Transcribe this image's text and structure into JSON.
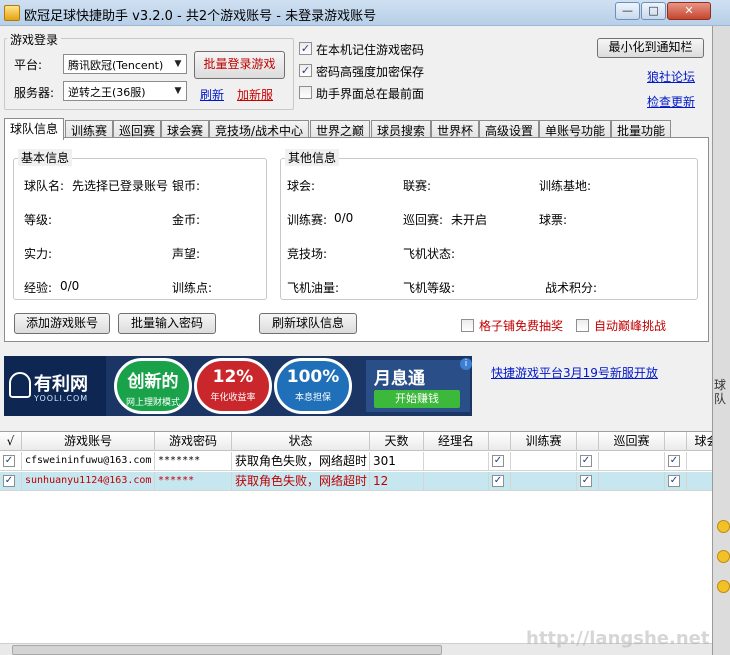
{
  "window": {
    "title": "欧冠足球快捷助手 v3.2.0  - 共2个游戏账号 - 未登录游戏账号",
    "minimize": "—",
    "maximize": "□",
    "close": "✕"
  },
  "login": {
    "group_title": "游戏登录",
    "platform_label": "平台:",
    "platform_value": "腾讯欧冠(Tencent)",
    "server_label": "服务器:",
    "server_value": "逆转之王(36服)",
    "batch_login_button": "批量登录游戏",
    "refresh_link": "刷新",
    "add_server_link": "加新服"
  },
  "options": {
    "remember_password": "在本机记住游戏密码",
    "encrypt_password": "密码高强度加密保存",
    "always_on_top": "助手界面总在最前面"
  },
  "right_panel": {
    "minimize_tray_button": "最小化到通知栏",
    "forum_link": "狼社论坛",
    "check_update_link": "检查更新"
  },
  "tabs": [
    "球队信息",
    "训练赛",
    "巡回赛",
    "球会赛",
    "竞技场/战术中心",
    "世界之巅",
    "球员搜索",
    "世界杯",
    "高级设置",
    "单账号功能",
    "批量功能"
  ],
  "basic_info": {
    "title": "基本信息",
    "team_name_label": "球队名:",
    "team_name_value": "先选择已登录账号",
    "silver_label": "银币:",
    "level_label": "等级:",
    "gold_label": "金币:",
    "strength_label": "实力:",
    "reputation_label": "声望:",
    "exp_label": "经验:",
    "exp_value": "0/0",
    "training_points_label": "训练点:"
  },
  "other_info": {
    "title": "其他信息",
    "club_label": "球会:",
    "league_label": "联赛:",
    "training_base_label": "训练基地:",
    "training_match_label": "训练赛:",
    "training_match_value": "0/0",
    "tour_label": "巡回赛:",
    "tour_value": "未开启",
    "ticket_label": "球票:",
    "arena_label": "竞技场:",
    "plane_status_label": "飞机状态:",
    "plane_fuel_label": "飞机油量:",
    "plane_level_label": "飞机等级:",
    "tactic_points_label": "战术积分:"
  },
  "actions": {
    "add_account_button": "添加游戏账号",
    "batch_password_button": "批量输入密码",
    "refresh_team_button": "刷新球队信息",
    "free_lottery": "格子铺免费抽奖",
    "auto_peak": "自动巅峰挑战"
  },
  "ad": {
    "logo_text": "有利网",
    "logo_sub": "YOOLI.COM",
    "c1_big": "创新的",
    "c1_small": "网上理财模式",
    "c2_big": "12%",
    "c2_small": "年化收益率",
    "c3_big": "100%",
    "c3_small": "本息担保",
    "month_text": "月息通",
    "month_btn": "开始赚钱",
    "info": "i",
    "announcement_link": "快捷游戏平台3月19号新服开放"
  },
  "table": {
    "headers": [
      "√",
      "游戏账号",
      "游戏密码",
      "状态",
      "天数",
      "经理名",
      "",
      "训练赛",
      "",
      "巡回赛",
      "",
      "球会"
    ],
    "rows": [
      {
        "checked": "✓",
        "account": "cfsweininfuwu@163.com",
        "password": "*******",
        "status": "获取角色失败，网络超时",
        "days": "301",
        "manager": "",
        "c1": "✓",
        "c2": "✓",
        "c3": "✓"
      },
      {
        "checked": "✓",
        "account": "sunhuanyu1124@163.com",
        "password": "******",
        "status": "获取角色失败，网络超时",
        "days": "12",
        "manager": "",
        "c1": "✓",
        "c2": "✓",
        "c3": "✓"
      }
    ]
  },
  "background": {
    "side_label": "球队",
    "watermark": "http://langshe.net"
  },
  "colors": {
    "link": "#0018c8",
    "error": "#c00000",
    "selected_row": "#c6e6f0"
  }
}
